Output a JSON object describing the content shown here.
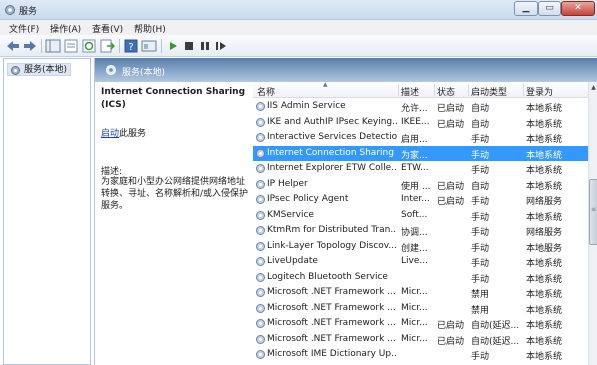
{
  "window": {
    "title": "服务"
  },
  "menu": [
    "文件(F)",
    "操作(A)",
    "查看(V)",
    "帮助(H)"
  ],
  "toolbar_icons": [
    "back-icon",
    "forward-icon",
    "show-tree-icon",
    "properties-icon",
    "refresh-icon",
    "export-icon",
    "help-icon",
    "console-icon",
    "start-icon",
    "stop-icon",
    "pause-icon",
    "restart-icon"
  ],
  "tree": {
    "item": "服务(本地)"
  },
  "pane": {
    "header": "服务(本地)"
  },
  "description": {
    "title": "Internet Connection Sharing (ICS)",
    "start_link": "启动",
    "start_suffix": "此服务",
    "label": "描述:",
    "text": "为家庭和小型办公网络提供网络地址转换、寻址、名称解析和/或入侵保护服务。"
  },
  "columns": {
    "name": "名称",
    "desc": "描述",
    "state": "状态",
    "start": "启动类型",
    "logon": "登录为"
  },
  "services": [
    {
      "name": "IIS Admin Service",
      "desc": "允许...",
      "state": "已启动",
      "start": "自动",
      "logon": "本地系统"
    },
    {
      "name": "IKE and AuthIP IPsec Keying...",
      "desc": "IKEE...",
      "state": "已启动",
      "start": "自动",
      "logon": "本地系统"
    },
    {
      "name": "Interactive Services Detection",
      "desc": "启用...",
      "state": "",
      "start": "手动",
      "logon": "本地系统"
    },
    {
      "name": "Internet Connection Sharing ...",
      "desc": "为家...",
      "state": "",
      "start": "手动",
      "logon": "本地系统",
      "selected": true
    },
    {
      "name": "Internet Explorer ETW Colle...",
      "desc": "ETW...",
      "state": "",
      "start": "手动",
      "logon": "本地系统"
    },
    {
      "name": "IP Helper",
      "desc": "使用 ...",
      "state": "已启动",
      "start": "自动",
      "logon": "本地系统"
    },
    {
      "name": "IPsec Policy Agent",
      "desc": "Inter...",
      "state": "已启动",
      "start": "手动",
      "logon": "网络服务"
    },
    {
      "name": "KMService",
      "desc": "Soft...",
      "state": "",
      "start": "手动",
      "logon": "本地系统"
    },
    {
      "name": "KtmRm for Distributed Tran...",
      "desc": "协调...",
      "state": "",
      "start": "手动",
      "logon": "网络服务"
    },
    {
      "name": "Link-Layer Topology Discov...",
      "desc": "创建...",
      "state": "",
      "start": "手动",
      "logon": "本地服务"
    },
    {
      "name": "LiveUpdate",
      "desc": "Live...",
      "state": "",
      "start": "手动",
      "logon": "本地系统"
    },
    {
      "name": "Logitech Bluetooth Service",
      "desc": "",
      "state": "",
      "start": "手动",
      "logon": "本地系统"
    },
    {
      "name": "Microsoft .NET Framework ...",
      "desc": "Micr...",
      "state": "",
      "start": "禁用",
      "logon": "本地系统"
    },
    {
      "name": "Microsoft .NET Framework ...",
      "desc": "Micr...",
      "state": "",
      "start": "禁用",
      "logon": "本地系统"
    },
    {
      "name": "Microsoft .NET Framework ...",
      "desc": "Micr...",
      "state": "已启动",
      "start": "自动(延迟...",
      "logon": "本地系统"
    },
    {
      "name": "Microsoft .NET Framework ...",
      "desc": "Micr...",
      "state": "已启动",
      "start": "自动(延迟...",
      "logon": "本地系统"
    },
    {
      "name": "Microsoft IME Dictionary Up...",
      "desc": "",
      "state": "",
      "start": "手动",
      "logon": "本地系统"
    }
  ]
}
